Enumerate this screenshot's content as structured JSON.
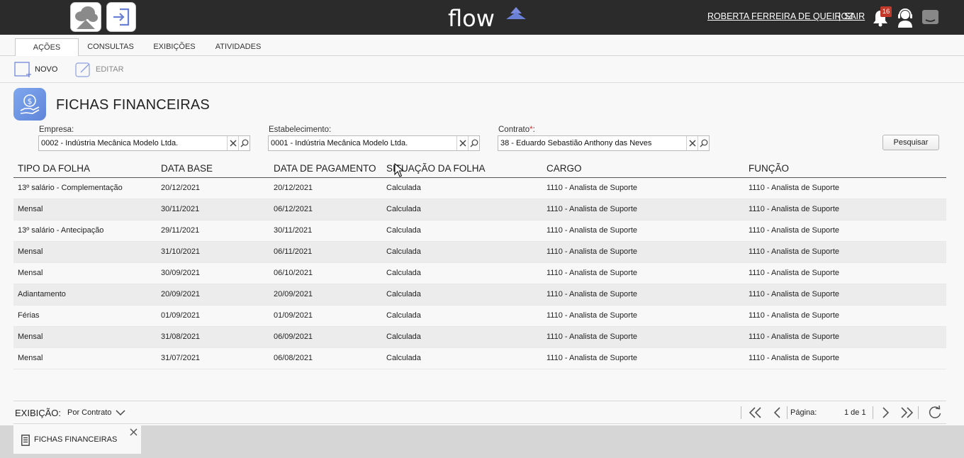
{
  "header": {
    "logo_text": "flow",
    "user_name": "ROBERTA FERREIRA DE QUEIROZ",
    "separator": "|",
    "logout_label": "SAIR",
    "notification_count": "16",
    "icons": [
      "home-cloud-icon",
      "sign-in-icon",
      "bell-icon",
      "support-agent-icon",
      "chat-icon"
    ]
  },
  "tabs": [
    {
      "label": "AÇÕES",
      "active": true
    },
    {
      "label": "CONSULTAS",
      "active": false
    },
    {
      "label": "EXIBIÇÕES",
      "active": false
    },
    {
      "label": "ATIVIDADES",
      "active": false
    }
  ],
  "toolbar": {
    "new_label": "NOVO",
    "edit_label": "EDITAR"
  },
  "page": {
    "title": "FICHAS FINANCEIRAS",
    "icon": "money-hand-icon"
  },
  "filters": {
    "empresa": {
      "label": "Empresa:",
      "value": "0002 - Indústria Mecânica Modelo Ltda."
    },
    "estabelecimento": {
      "label": "Estabelecimento:",
      "value": "0001 - Indústria Mecânica Modelo Ltda."
    },
    "contrato": {
      "label": "Contrato",
      "required_mark": "*",
      "colon": ":",
      "value": "38 - Eduardo Sebastião Anthony das Neves"
    },
    "search_button": "Pesquisar"
  },
  "table": {
    "columns": [
      "TIPO DA FOLHA",
      "DATA BASE",
      "DATA DE PAGAMENTO",
      "SITUAÇÃO DA FOLHA",
      "CARGO",
      "FUNÇÃO"
    ],
    "rows": [
      [
        "13º salário - Complementação",
        "20/12/2021",
        "20/12/2021",
        "Calculada",
        "1110 - Analista de Suporte",
        "1110 - Analista de Suporte"
      ],
      [
        "Mensal",
        "30/11/2021",
        "06/12/2021",
        "Calculada",
        "1110 - Analista de Suporte",
        "1110 - Analista de Suporte"
      ],
      [
        "13º salário - Antecipação",
        "29/11/2021",
        "30/11/2021",
        "Calculada",
        "1110 - Analista de Suporte",
        "1110 - Analista de Suporte"
      ],
      [
        "Mensal",
        "31/10/2021",
        "06/11/2021",
        "Calculada",
        "1110 - Analista de Suporte",
        "1110 - Analista de Suporte"
      ],
      [
        "Mensal",
        "30/09/2021",
        "06/10/2021",
        "Calculada",
        "1110 - Analista de Suporte",
        "1110 - Analista de Suporte"
      ],
      [
        "Adiantamento",
        "20/09/2021",
        "20/09/2021",
        "Calculada",
        "1110 - Analista de Suporte",
        "1110 - Analista de Suporte"
      ],
      [
        "Férias",
        "01/09/2021",
        "01/09/2021",
        "Calculada",
        "1110 - Analista de Suporte",
        "1110 - Analista de Suporte"
      ],
      [
        "Mensal",
        "31/08/2021",
        "06/09/2021",
        "Calculada",
        "1110 - Analista de Suporte",
        "1110 - Analista de Suporte"
      ],
      [
        "Mensal",
        "31/07/2021",
        "06/08/2021",
        "Calculada",
        "1110 - Analista de Suporte",
        "1110 - Analista de Suporte"
      ]
    ]
  },
  "footer": {
    "view_label": "EXIBIÇÃO:",
    "view_value": "Por Contrato",
    "page_label": "Página:",
    "page_info": "1 de 1"
  },
  "bottom_tab": {
    "label": "FICHAS FINANCEIRAS"
  },
  "colors": {
    "topbar": "#2b2b2b",
    "accent": "#6a7fd6",
    "badge": "#c0392b",
    "row_alt": "#ececec"
  }
}
